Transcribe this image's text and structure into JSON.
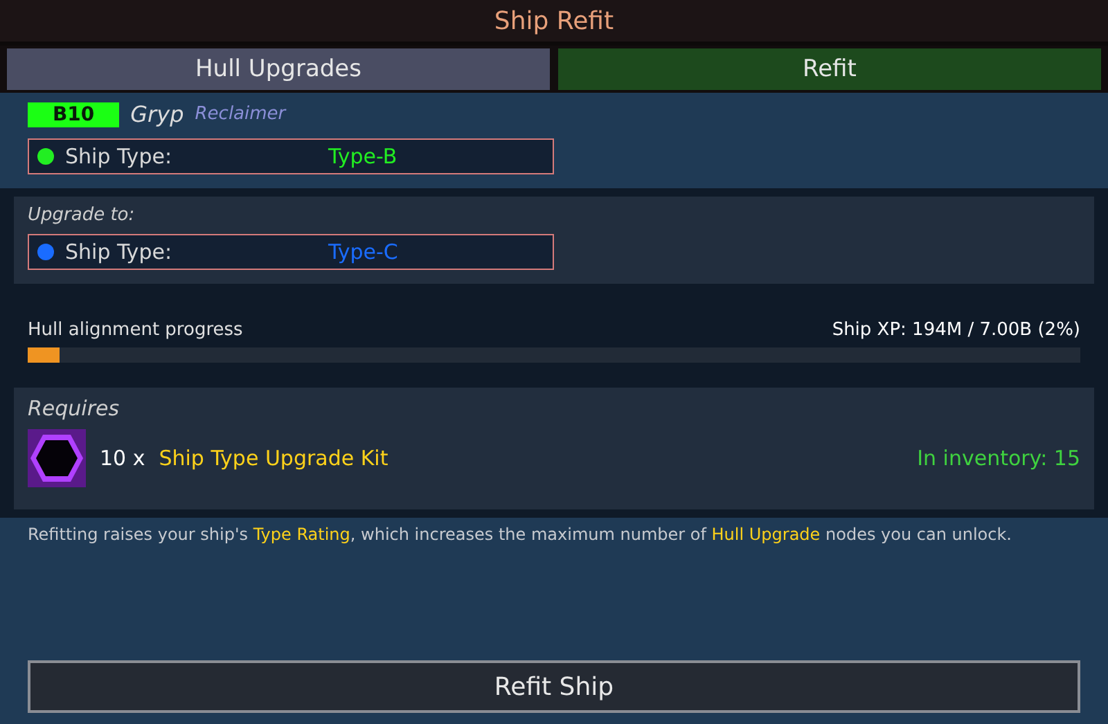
{
  "window": {
    "title": "Ship Refit"
  },
  "tabs": [
    {
      "label": "Hull Upgrades",
      "selected": false
    },
    {
      "label": "Refit",
      "selected": true
    }
  ],
  "ship": {
    "badge": "B10",
    "name": "Gryp",
    "class": "Reclaimer",
    "type_label": "Ship Type:",
    "type_value": "Type-B",
    "color": "#22ee22"
  },
  "upgrade": {
    "heading": "Upgrade to:",
    "type_label": "Ship Type:",
    "type_value": "Type-C",
    "color": "#1a6cff"
  },
  "progress": {
    "label": "Hull alignment progress",
    "reading": "Ship XP: 194M / 7.00B  (2%)",
    "level": 0.03
  },
  "requires": {
    "heading": "Requires",
    "quantity": "10 x",
    "item": "Ship Type Upgrade Kit",
    "inventory": "In inventory: 15"
  },
  "description": "Refitting raises your ship's **Type Rating**, which increases the maximum number of **Hull Upgrade** nodes you can unlock.",
  "button": "Refit Ship"
}
